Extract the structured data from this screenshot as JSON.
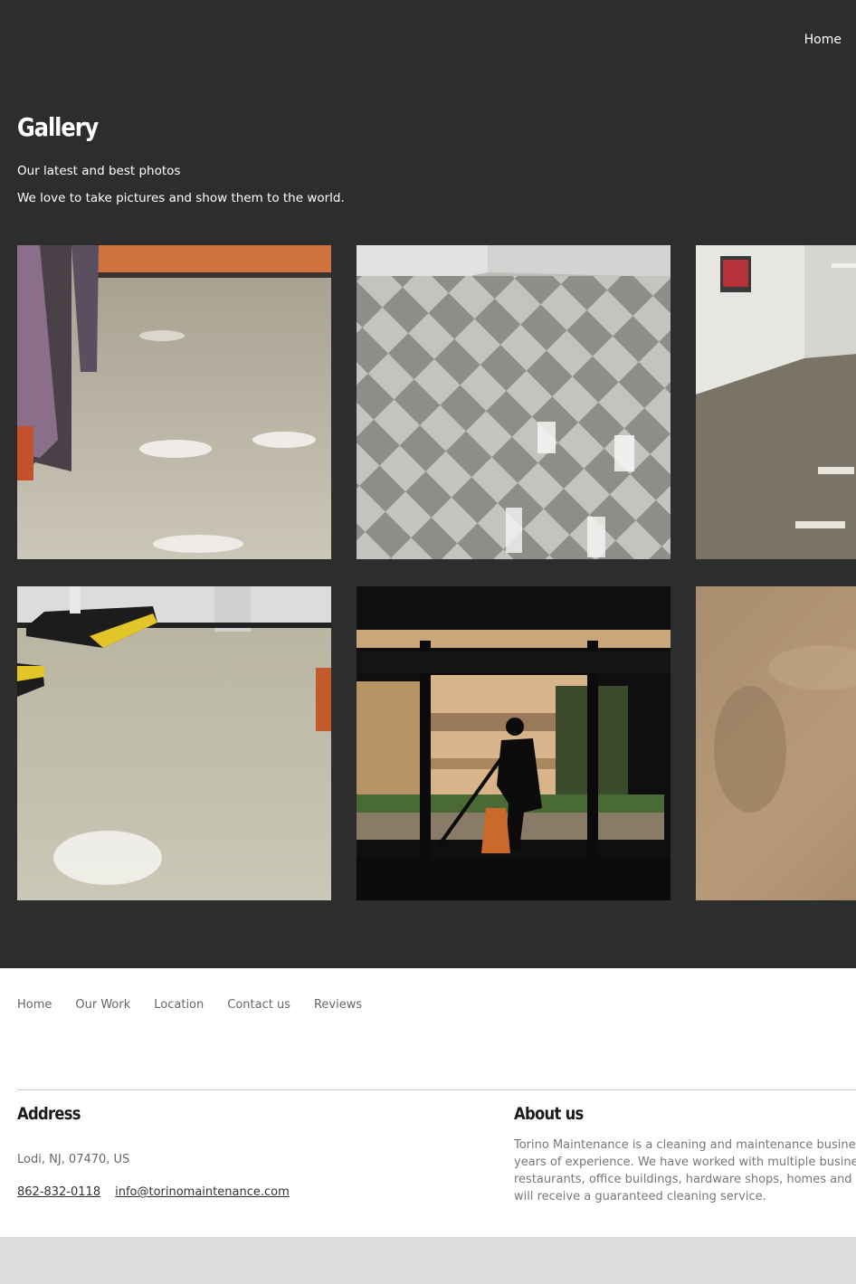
{
  "header": {
    "nav_home": "Home"
  },
  "gallery": {
    "title": "Gallery",
    "subtitle_1": "Our latest and best photos",
    "subtitle_2": "We love to take pictures and show them to the world."
  },
  "footer": {
    "nav": [
      "Home",
      "Our Work",
      "Location",
      "Contact us",
      "Reviews"
    ],
    "address_heading": "Address",
    "address": "Lodi, NJ, 07470, US",
    "phone": "862-832-0118",
    "email": "info@torinomaintenance.com",
    "about_heading": "About us",
    "about_lines": [
      "Torino Maintenance is a cleaning and maintenance business",
      "years of experience. We have worked with multiple businesse",
      "restaurants, office buildings, hardware shops, homes and mo",
      "will receive a guaranteed cleaning service."
    ]
  }
}
